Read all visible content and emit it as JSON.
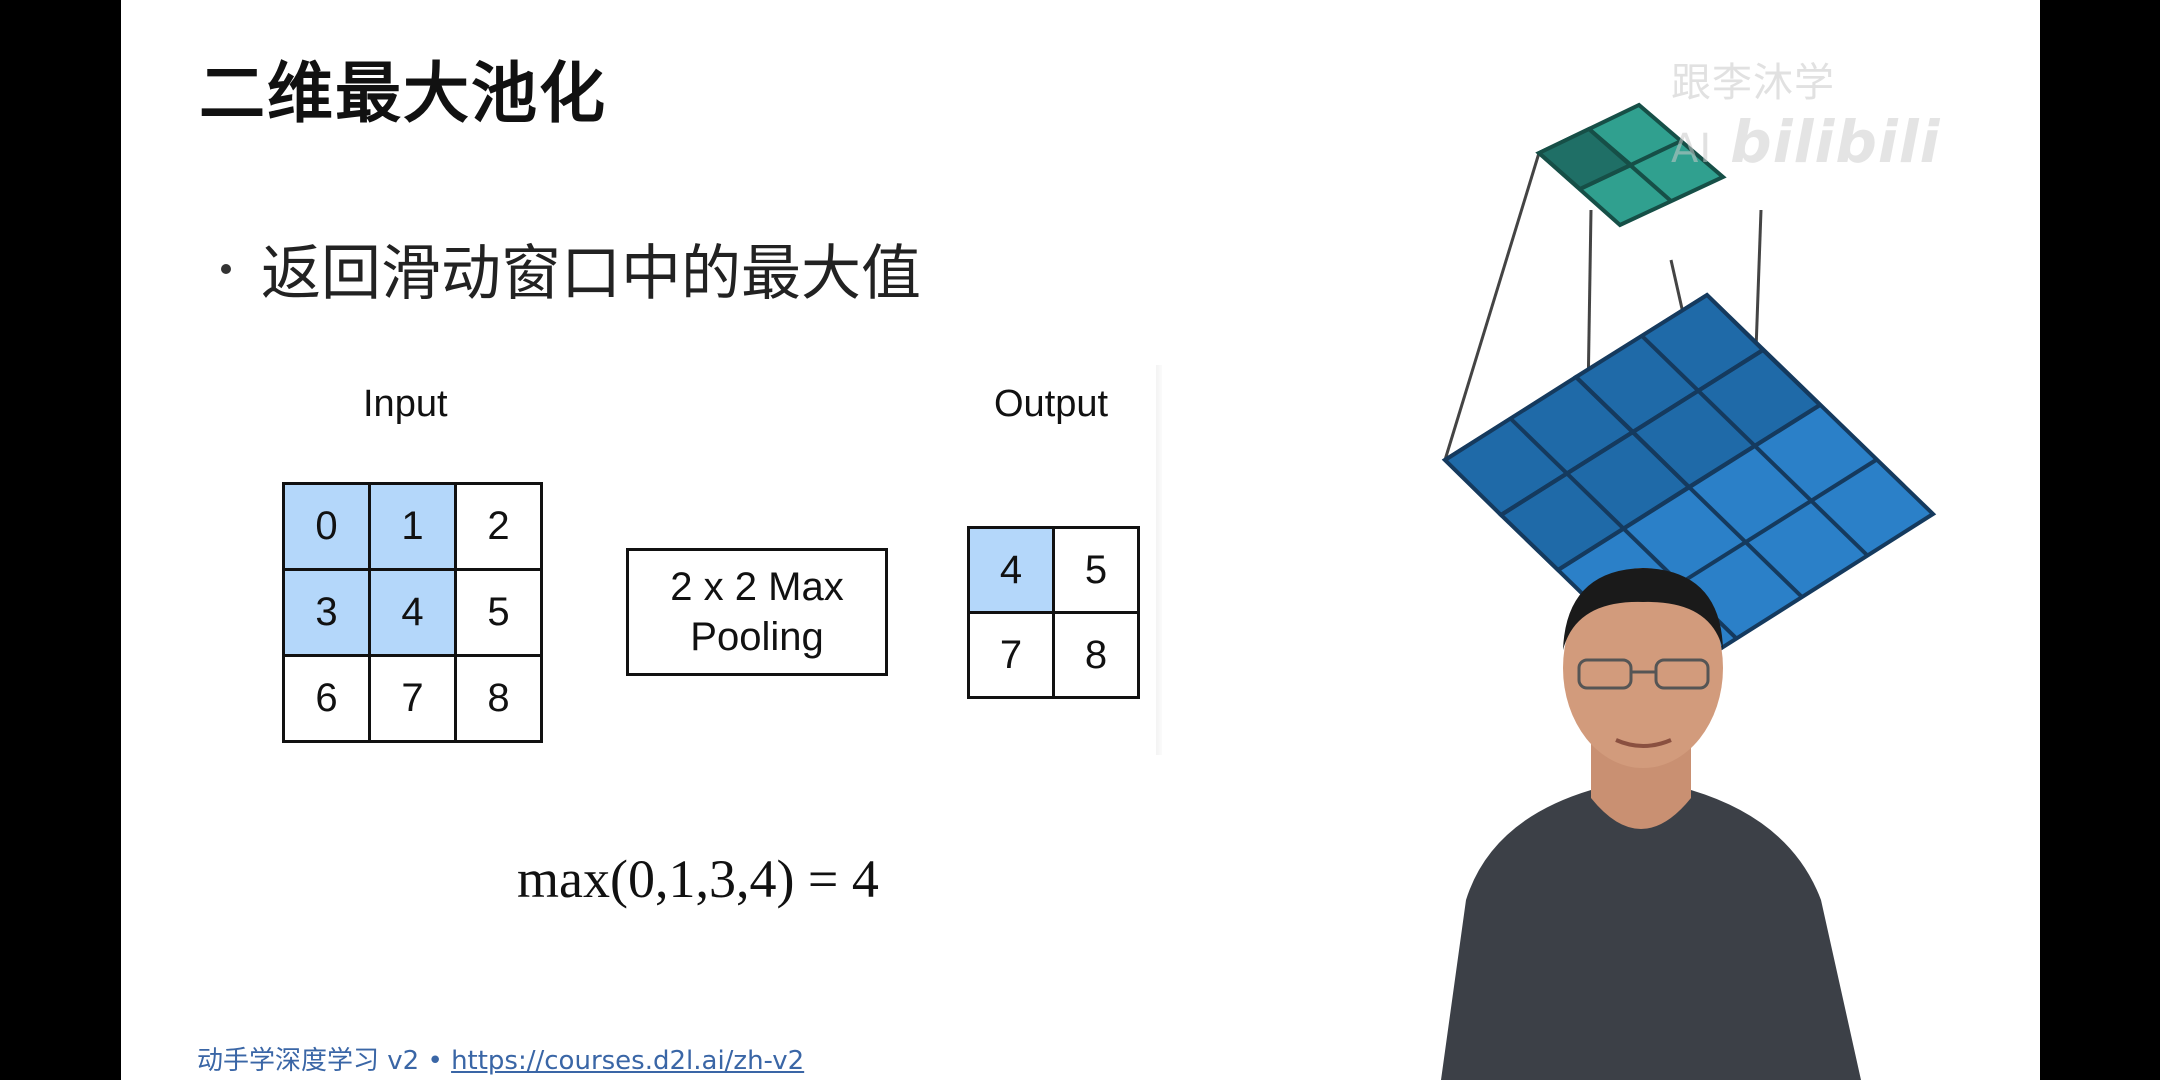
{
  "slide": {
    "title": "二维最大池化",
    "bullet": "返回滑动窗口中的最大值",
    "input_caption": "Input",
    "output_caption": "Output",
    "input_grid": [
      [
        "0",
        "1",
        "2"
      ],
      [
        "3",
        "4",
        "5"
      ],
      [
        "6",
        "7",
        "8"
      ]
    ],
    "output_grid": [
      [
        "4",
        "5"
      ],
      [
        "7",
        "8"
      ]
    ],
    "pool_label_line1": "2 x 2 Max",
    "pool_label_line2": "Pooling",
    "formula": "max(0,1,3,4) = 4",
    "footer_text": "动手学深度学习 v2 • ",
    "footer_link": "https://courses.d2l.ai/zh-v2"
  },
  "watermark": {
    "text": "跟李沐学AI",
    "logo": "bilibili"
  },
  "colors": {
    "highlight": "#b4d7fa",
    "pool_top": "#2a9d8f",
    "pool_bottom": "#2277c0",
    "link": "#3a66a6"
  }
}
